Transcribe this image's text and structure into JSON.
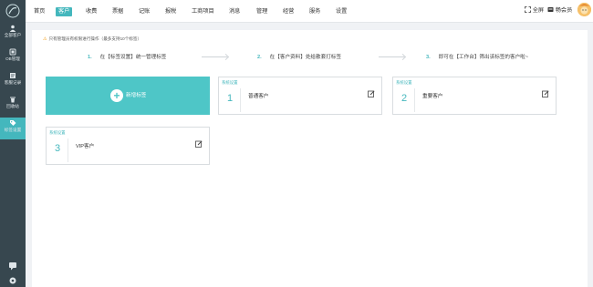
{
  "sidebar": {
    "items": [
      {
        "label": "全部客户",
        "icon": "users-icon"
      },
      {
        "label": "OB管理",
        "icon": "ob-icon"
      },
      {
        "label": "客服记录",
        "icon": "record-icon"
      },
      {
        "label": "回收站",
        "icon": "trash-icon"
      },
      {
        "label": "标签设置",
        "icon": "tag-icon",
        "active": true
      }
    ]
  },
  "topnav": {
    "items": [
      "首页",
      "客户",
      "收费",
      "票据",
      "记账",
      "报税",
      "工商项目",
      "消息",
      "管理",
      "经营",
      "服务",
      "设置"
    ],
    "active": "客户",
    "fullscreen": "全屏",
    "member": "畅会员"
  },
  "notice": "只有管理员有权限进行操作（最多支持10个标签）",
  "steps": [
    {
      "num": "1.",
      "text": "在【标签设置】统一管理标签"
    },
    {
      "num": "2.",
      "text": "在【客户资料】处给散套打标签"
    },
    {
      "num": "3.",
      "text": "即可在【工作台】筛出该标签的客户啦~"
    }
  ],
  "add_tag": "新增标签",
  "tags": [
    {
      "system_label": "系统设置",
      "index": "1",
      "name": "普通客户"
    },
    {
      "system_label": "系统设置",
      "index": "2",
      "name": "重要客户"
    },
    {
      "system_label": "系统设置",
      "index": "3",
      "name": "VIP客户"
    }
  ],
  "colors": {
    "accent": "#44b7bd",
    "sidebar": "#37474f",
    "add_card": "#4ec6c7",
    "warn": "#f39c12"
  }
}
